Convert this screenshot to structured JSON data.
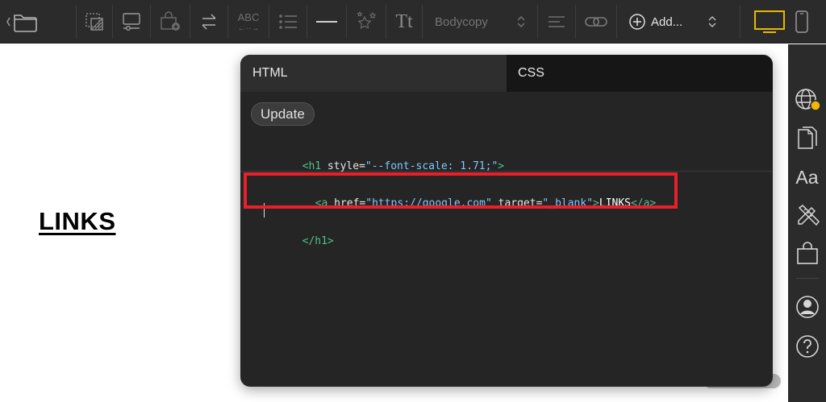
{
  "toolbar": {
    "paragraph_style": "Bodycopy",
    "abc_label": "ABC",
    "abc_arrows": "←··→",
    "tt_label": "Tt",
    "add_label": "Add..."
  },
  "canvas": {
    "heading": "LINKS"
  },
  "editor": {
    "tabs": [
      {
        "label": "HTML"
      },
      {
        "label": "CSS"
      }
    ],
    "update_label": "Update",
    "code": {
      "line1": {
        "open": "<h1",
        "attr": " style=",
        "val": "\"--font-scale: 1.71;\"",
        "close": ">"
      },
      "line2": {
        "open": "<a",
        "attr1": " href=",
        "val1": "\"https://google.com\"",
        "attr2": " target=",
        "val2": "\"_blank\"",
        "close": ">",
        "text": "LINKS",
        "end": "</a>"
      },
      "line3": {
        "end": "</h1>"
      }
    }
  },
  "colors": {
    "highlight": "#e8202a",
    "toolbar_bg": "#2b2b2b",
    "monitor_active": "#e6b800",
    "globe_badge": "#f2b705"
  }
}
